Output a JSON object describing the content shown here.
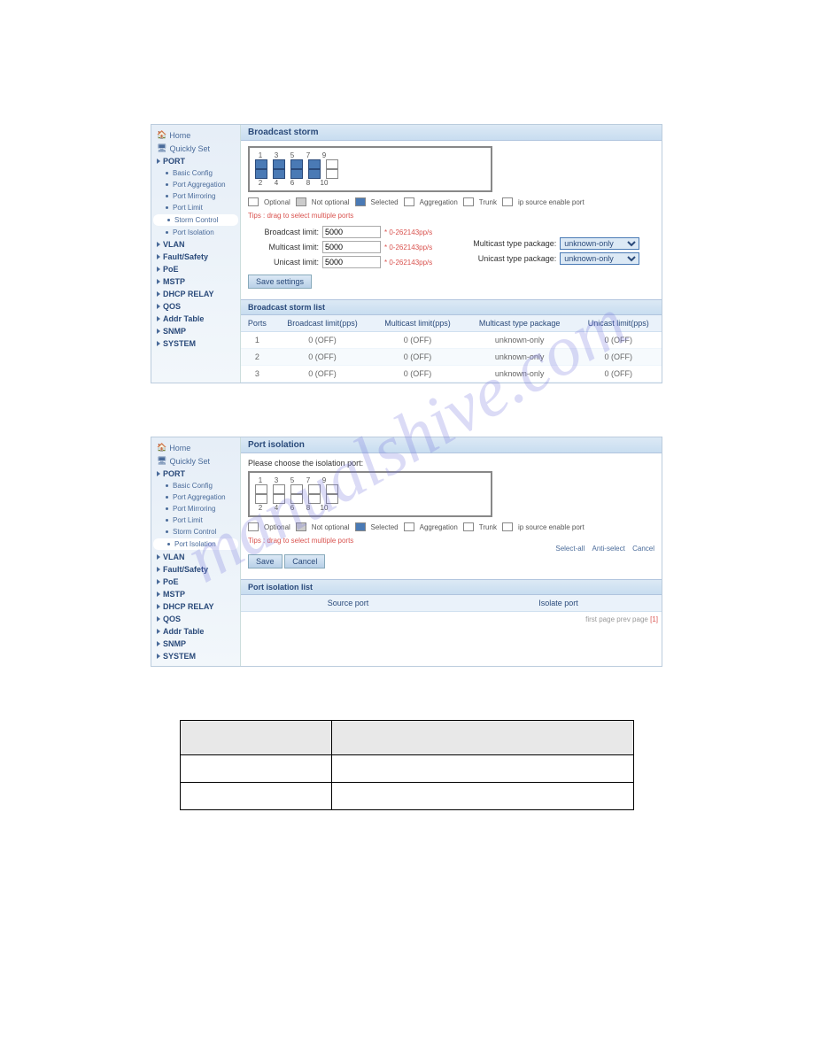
{
  "watermark": "manualshive.com",
  "sidebar": {
    "home": "Home",
    "quick": "Quickly Set",
    "sections": [
      {
        "label": "PORT",
        "items": [
          "Basic Config",
          "Port Aggregation",
          "Port Mirroring",
          "Port Limit",
          "Storm Control",
          "Port Isolation"
        ]
      },
      {
        "label": "VLAN"
      },
      {
        "label": "Fault/Safety"
      },
      {
        "label": "PoE"
      },
      {
        "label": "MSTP"
      },
      {
        "label": "DHCP RELAY"
      },
      {
        "label": "QOS"
      },
      {
        "label": "Addr Table"
      },
      {
        "label": "SNMP"
      },
      {
        "label": "SYSTEM"
      }
    ],
    "active1": "Storm Control",
    "active2": "Port Isolation"
  },
  "shot1": {
    "title": "Broadcast storm",
    "port_nums_top": [
      "1",
      "3",
      "5",
      "7",
      "9"
    ],
    "port_nums_bot": [
      "2",
      "4",
      "6",
      "8",
      "10"
    ],
    "legend": {
      "opt": "Optional",
      "nopt": "Not optional",
      "sel": "Selected",
      "agg": "Aggregation",
      "trunk": "Trunk",
      "ipsrc": "ip source enable port",
      "tips": "Tips : drag to select multiple ports"
    },
    "form": {
      "bc_label": "Broadcast limit:",
      "bc_val": "5000",
      "bc_hint": "* 0-262143pp/s",
      "mc_label": "Multicast limit:",
      "mc_val": "5000",
      "mc_hint": "* 0-262143pp/s",
      "uc_label": "Unicast limit:",
      "uc_val": "5000",
      "uc_hint": "* 0-262143pp/s",
      "mc_pkg_label": "Multicast type package:",
      "mc_pkg_val": "unknown-only",
      "uc_pkg_label": "Unicast type package:",
      "uc_pkg_val": "unknown-only",
      "save": "Save settings"
    },
    "list_title": "Broadcast storm list",
    "cols": [
      "Ports",
      "Broadcast limit(pps)",
      "Multicast limit(pps)",
      "Multicast type package",
      "Unicast limit(pps)"
    ],
    "rows": [
      [
        "1",
        "0 (OFF)",
        "0 (OFF)",
        "unknown-only",
        "0 (OFF)"
      ],
      [
        "2",
        "0 (OFF)",
        "0 (OFF)",
        "unknown-only",
        "0 (OFF)"
      ],
      [
        "3",
        "0 (OFF)",
        "0 (OFF)",
        "unknown-only",
        "0 (OFF)"
      ]
    ]
  },
  "shot2": {
    "title": "Port isolation",
    "prompt": "Please choose the isolation port:",
    "port_nums_top": [
      "1",
      "3",
      "5",
      "7",
      "9"
    ],
    "port_nums_bot": [
      "2",
      "4",
      "6",
      "8",
      "10"
    ],
    "legend": {
      "opt": "Optional",
      "nopt": "Not optional",
      "sel": "Selected",
      "agg": "Aggregation",
      "trunk": "Trunk",
      "ipsrc": "ip source enable port",
      "tips": "Tips : drag to select multiple ports"
    },
    "links": {
      "selall": "Select-all",
      "anti": "Anti-select",
      "cancel": "Cancel"
    },
    "btn_save": "Save",
    "btn_cancel": "Cancel",
    "list_title": "Port isolation list",
    "cols": [
      "Source port",
      "Isolate port"
    ],
    "pager": {
      "first": "first page",
      "prev": "prev page",
      "cur": "[1]"
    }
  }
}
